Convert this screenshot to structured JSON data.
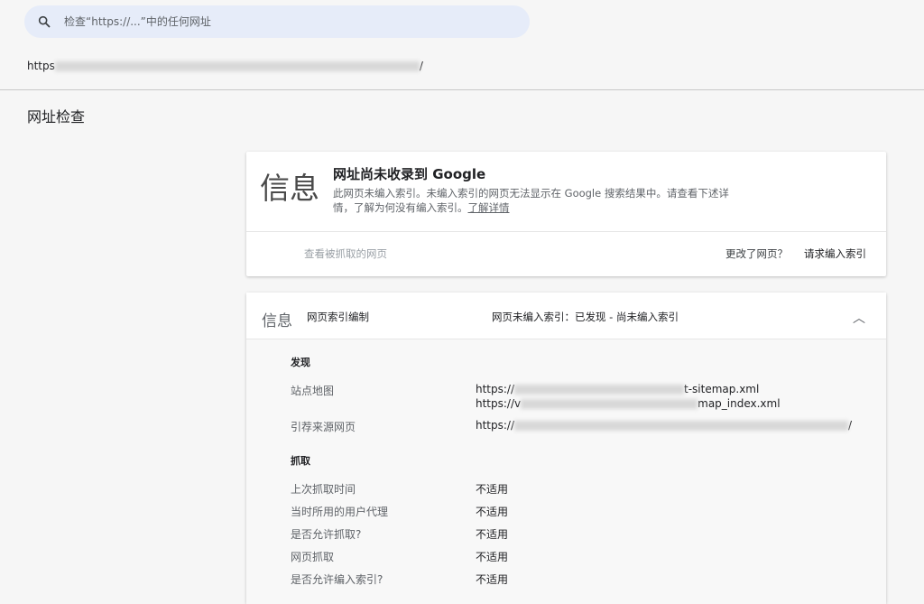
{
  "search": {
    "placeholder": "检查“https://...”中的任何网址"
  },
  "inspected_url": {
    "prefix": "https",
    "suffix": "/"
  },
  "page_title": "网址检查",
  "summary_card": {
    "label": "信息",
    "heading": "网址尚未收录到 Google",
    "description": "此网页未编入索引。未编入索引的网页无法显示在 Google 搜索结果中。请查看下述详情，了解为何没有编入索引。",
    "learn_more": "了解详情",
    "view_crawled": "查看被抓取的网页",
    "page_changed": "更改了网页？",
    "request_indexing": "请求编入索引"
  },
  "indexing_card": {
    "label": "信息",
    "name": "网页索引编制",
    "status": "网页未编入索引：已发现 - 尚未编入索引",
    "discovery": {
      "title": "发现",
      "sitemap_key": "站点地图",
      "sitemap_v1_prefix": "https://",
      "sitemap_v1_suffix": "t-sitemap.xml",
      "sitemap_v2_prefix": "https://v",
      "sitemap_v2_suffix": "map_index.xml",
      "referrer_key": "引荐来源网页",
      "referrer_prefix": "https://",
      "referrer_suffix": "/"
    },
    "crawl": {
      "title": "抓取",
      "rows": [
        {
          "key": "上次抓取时间",
          "value": "不适用"
        },
        {
          "key": "当时所用的用户代理",
          "value": "不适用"
        },
        {
          "key": "是否允许抓取?",
          "value": "不适用"
        },
        {
          "key": "网页抓取",
          "value": "不适用"
        },
        {
          "key": "是否允许编入索引?",
          "value": "不适用"
        }
      ]
    }
  }
}
